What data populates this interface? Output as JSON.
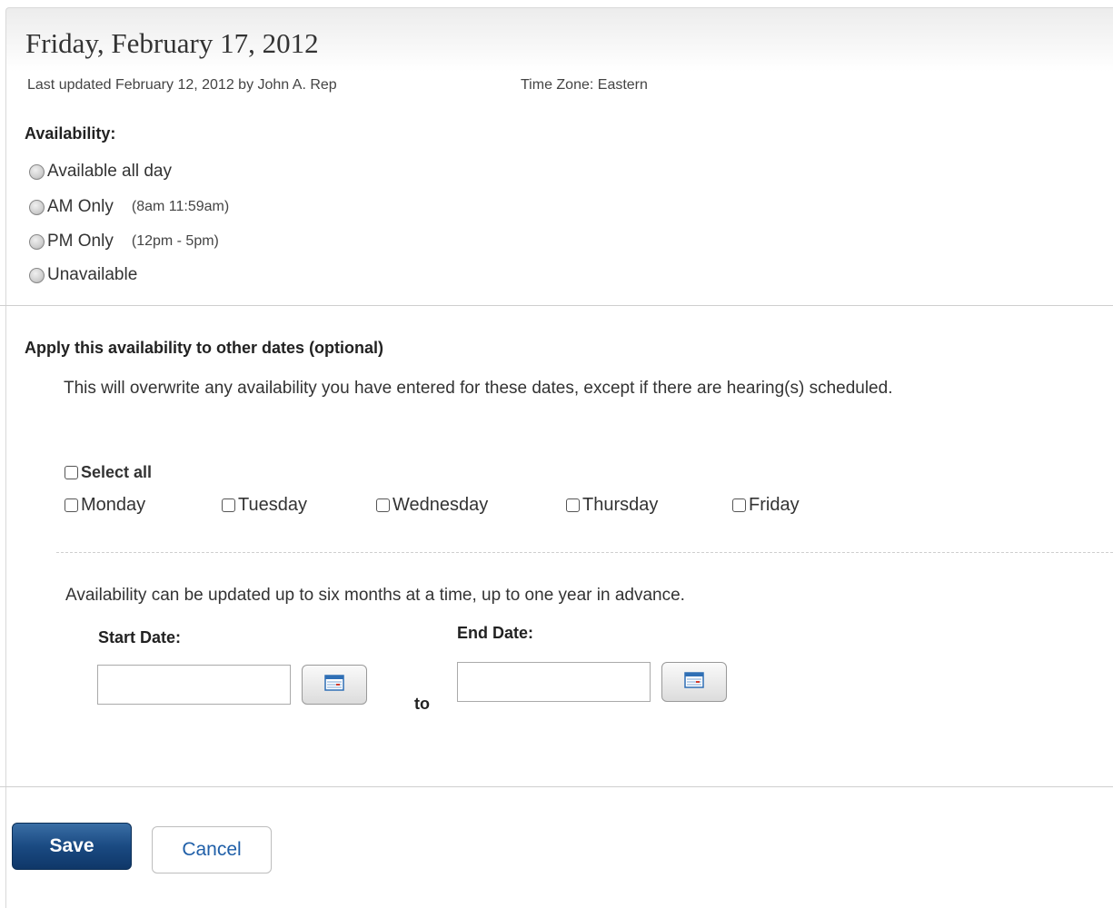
{
  "header": {
    "title": "Friday, February 17, 2012",
    "last_updated": "Last updated February 12, 2012 by John A. Rep",
    "time_zone": "Time Zone: Eastern"
  },
  "availability": {
    "label": "Availability:",
    "options": [
      {
        "label": "Available all day",
        "hint": ""
      },
      {
        "label": "AM Only",
        "hint": "(8am  11:59am)"
      },
      {
        "label": "PM Only",
        "hint": "(12pm - 5pm)"
      },
      {
        "label": "Unavailable",
        "hint": ""
      }
    ]
  },
  "apply": {
    "heading": "Apply this availability to other dates (optional)",
    "description": "This will overwrite any availability you have entered for these dates, except if there are hearing(s) scheduled.",
    "select_all": "Select all",
    "days": [
      "Monday",
      "Tuesday",
      "Wednesday",
      "Thursday",
      "Friday"
    ],
    "range_note": "Availability can be updated up to six months at a time, up to one year in advance.",
    "start_label": "Start Date:",
    "end_label": "End Date:",
    "to_label": "to",
    "start_value": "",
    "end_value": ""
  },
  "actions": {
    "save_label": "Save",
    "cancel_label": "Cancel"
  },
  "colors": {
    "save_button": "#1a4a82",
    "cancel_text": "#1f5fa8",
    "calendar_icon": "#2f6fb5",
    "calendar_marker": "#d33b2f"
  },
  "icons": {
    "calendar": "calendar-icon"
  }
}
